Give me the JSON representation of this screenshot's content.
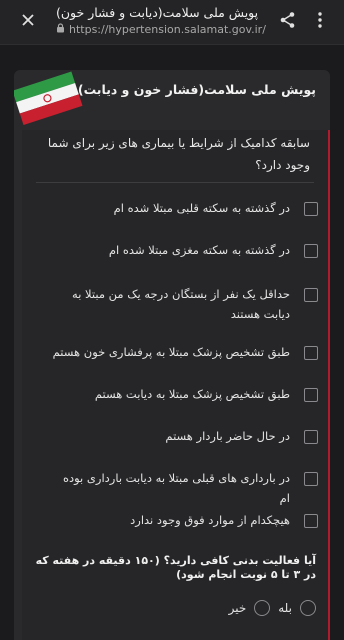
{
  "browser": {
    "title": "پویش ملی سلامت(دیابت و فشار خون)",
    "url": "https://hypertension.salamat.gov.ir/"
  },
  "header": {
    "title": "پویش ملی سلامت(فشار خون و دیابت)"
  },
  "question1": {
    "text": "سابقه کدامیک از شرایط یا بیماری های زیر برای شما وجود دارد؟",
    "options": [
      "در گذشته به سکته قلبی مبتلا شده ام",
      "در گذشته به سکته مغزی مبتلا شده ام",
      "حداقل یک نفر از بستگان درجه یک من مبتلا به دیابت هستند",
      "طبق تشخیص پزشک مبتلا به پرفشاری خون هستم",
      "طبق تشخیص پزشک مبتلا به دیابت هستم",
      "در حال حاضر باردار هستم",
      "در بارداری های قبلی مبتلا به دیابت بارداری بوده ام",
      "هیچکدام از موارد فوق وجود ندارد"
    ]
  },
  "question2": {
    "text": "آیا فعالیت بدنی کافی دارید؟ (۱۵۰ دقیقه در هفته که در ۳ تا ۵ نوبت انجام شود)",
    "yes": "بله",
    "no": "خیر"
  },
  "colors": {
    "accent": "#b01c2e"
  }
}
